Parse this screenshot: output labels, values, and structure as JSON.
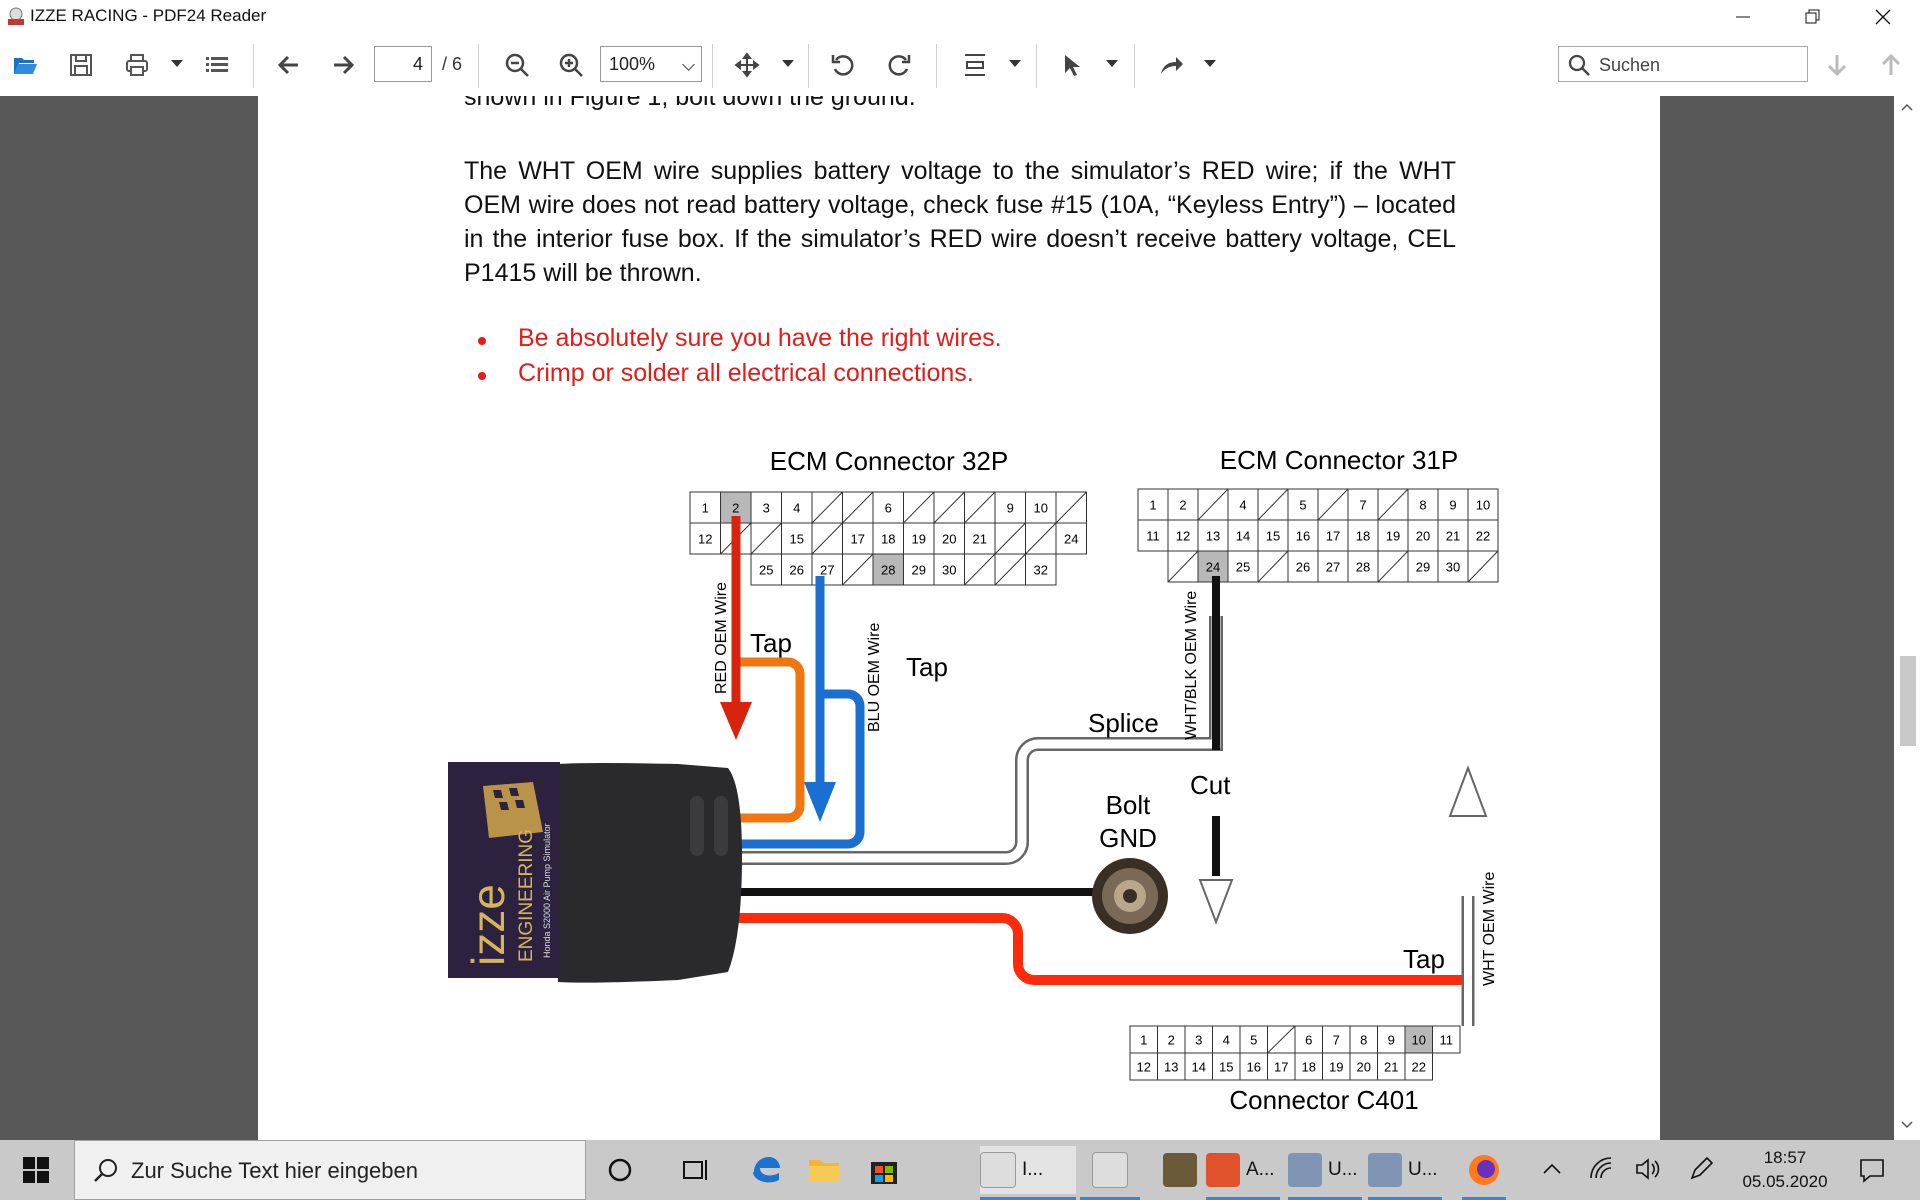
{
  "window": {
    "title": "IZZE RACING - PDF24 Reader"
  },
  "toolbar": {
    "page_current": "4",
    "page_total": "/ 6",
    "zoom": "100%",
    "search_placeholder": "Suchen"
  },
  "document": {
    "line_top": "shown in Figure 1, bolt down the ground.",
    "paragraph": "The WHT OEM wire supplies battery voltage to the simulator’s RED wire; if the WHT OEM wire does not read battery voltage, check fuse #15 (10A, “Keyless Entry”) – located in the interior fuse box. If the simulator’s RED wire doesn’t receive battery voltage, CEL P1415 will be thrown.",
    "bullets": [
      "Be absolutely sure you have the right wires.",
      "Crimp or solder all electrical connections."
    ]
  },
  "diagram": {
    "ecm32_title": "ECM Connector 32P",
    "ecm31_title": "ECM Connector 31P",
    "c401_title": "Connector C401",
    "red_wire_label": "RED OEM Wire",
    "blu_wire_label": "BLU OEM Wire",
    "whtblk_wire_label": "WHT/BLK OEM Wire",
    "wht_wire_label": "WHT OEM Wire",
    "tap1": "Tap",
    "tap2": "Tap",
    "tap3": "Tap",
    "splice": "Splice",
    "cut": "Cut",
    "bolt_line1": "Bolt",
    "bolt_line2": "GND",
    "device_brand": "izze",
    "device_sub": "ENGINEERING",
    "device_small": "Honda S2000 Air Pump Simulator",
    "ecm32_row1": [
      "1",
      "2",
      "3",
      "4",
      "",
      "",
      "6",
      "",
      "",
      "",
      "9",
      "10",
      ""
    ],
    "ecm32_row2": [
      "12",
      "",
      "",
      "15",
      "",
      "17",
      "18",
      "19",
      "20",
      "21",
      "",
      "",
      "24"
    ],
    "ecm32_row3": [
      "25",
      "26",
      "27",
      "",
      "28",
      "29",
      "30",
      "",
      "",
      "32"
    ],
    "ecm31_row1": [
      "1",
      "2",
      "",
      "4",
      "",
      "5",
      "",
      "7",
      "",
      "8",
      "9",
      "10"
    ],
    "ecm31_row2": [
      "11",
      "12",
      "13",
      "14",
      "15",
      "16",
      "17",
      "18",
      "19",
      "20",
      "21",
      "22"
    ],
    "ecm31_row3": [
      "",
      "24",
      "25",
      "",
      "26",
      "27",
      "28",
      "",
      "29",
      "30",
      ""
    ],
    "c401_row1": [
      "1",
      "2",
      "3",
      "4",
      "5",
      "",
      "6",
      "7",
      "8",
      "9",
      "10",
      "11"
    ],
    "c401_row2": [
      "12",
      "13",
      "14",
      "15",
      "16",
      "17",
      "18",
      "19",
      "20",
      "21",
      "22"
    ]
  },
  "taskbar": {
    "search_placeholder": "Zur Suche Text hier eingeben",
    "apps": [
      "I...",
      "",
      "",
      "A...",
      "U...",
      "U..."
    ],
    "time": "18:57",
    "date": "05.05.2020"
  }
}
